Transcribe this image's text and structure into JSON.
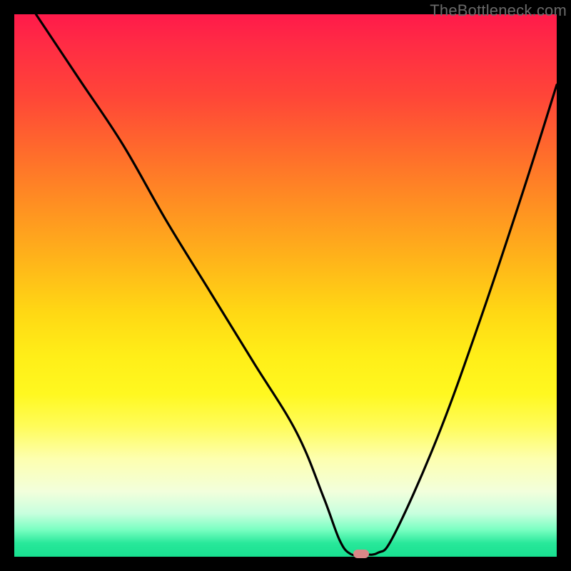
{
  "watermark": "TheBottleneck.com",
  "chart_data": {
    "type": "line",
    "title": "",
    "xlabel": "",
    "ylabel": "",
    "xlim": [
      0,
      100
    ],
    "ylim": [
      0,
      100
    ],
    "grid": false,
    "series": [
      {
        "name": "bottleneck-curve",
        "x": [
          4,
          12,
          20,
          28,
          36,
          44,
          52,
          57,
          60,
          62,
          64,
          67,
          70,
          78,
          86,
          94,
          100
        ],
        "values": [
          100,
          88,
          76,
          62,
          49,
          36,
          23,
          11,
          3,
          0.5,
          0.5,
          0.7,
          4,
          22,
          44,
          68,
          87
        ]
      }
    ],
    "marker": {
      "x": 64,
      "y": 0.5
    },
    "gradient_stops": [
      {
        "pos": 0,
        "color": "#ff1a4a"
      },
      {
        "pos": 0.45,
        "color": "#ffd814"
      },
      {
        "pos": 0.82,
        "color": "#fdffb0"
      },
      {
        "pos": 1.0,
        "color": "#18e090"
      }
    ]
  }
}
